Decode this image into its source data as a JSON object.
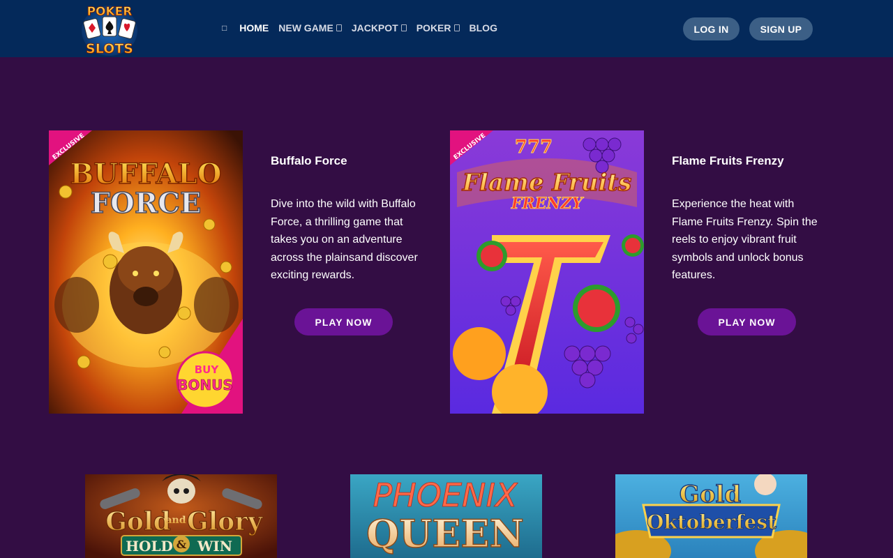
{
  "header": {
    "logo": {
      "line1": "POKER",
      "line2": "SLOTS"
    },
    "nav": [
      {
        "label": "",
        "icon": "home-icon"
      },
      {
        "label": "HOME"
      },
      {
        "label": "NEW GAME",
        "dropdown": true
      },
      {
        "label": "JACKPOT",
        "dropdown": true
      },
      {
        "label": "POKER",
        "dropdown": true
      },
      {
        "label": "BLOG"
      }
    ],
    "login_label": "LOG IN",
    "signup_label": "SIGN UP"
  },
  "features": [
    {
      "title": "Buffalo Force",
      "description": "Dive into the wild with Buffalo Force, a thrilling game that takes you on an adventure across the plainsand discover exciting rewards.",
      "button_label": "PLAY NOW",
      "image": {
        "badge": "EXCLUSIVE",
        "line1": "BUFFALO",
        "line2": "FORCE",
        "bonus1": "BUY",
        "bonus2": "BONUS"
      }
    },
    {
      "title": "Flame Fruits Frenzy",
      "description": "Experience the heat with Flame Fruits Frenzy. Spin the reels to enjoy vibrant fruit symbols and unlock bonus features.",
      "button_label": "PLAY NOW",
      "image": {
        "badge": "EXCLUSIVE",
        "line1": "Flame Fruits",
        "line2": "FRENZY",
        "top": "777"
      }
    }
  ],
  "thumbs": [
    {
      "line1": "Gold",
      "and": "and",
      "line2": "Glory",
      "line3": "HOLD",
      "amp": "&",
      "line4": "WIN"
    },
    {
      "line1": "PHOENIX",
      "line2": "QUEEN"
    },
    {
      "line1": "Gold",
      "line2": "Oktoberfest"
    }
  ],
  "colors": {
    "header_bg": "#04295a",
    "page_bg": "#330d44",
    "play_button": "#6a1396",
    "auth_button": "#3c5f86"
  }
}
